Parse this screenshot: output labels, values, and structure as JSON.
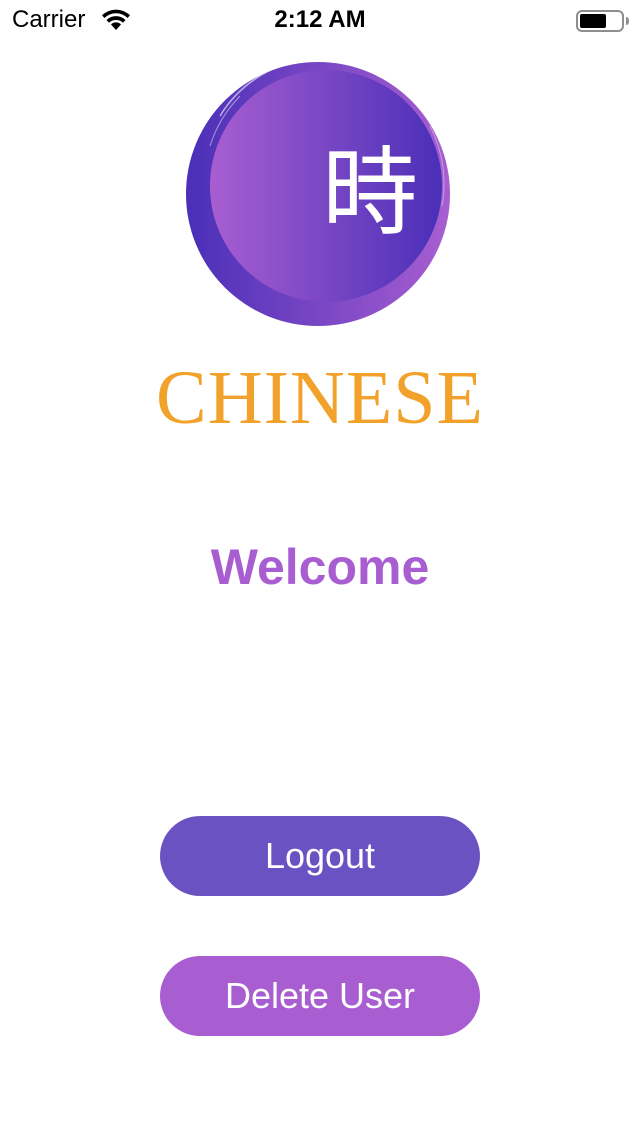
{
  "status_bar": {
    "carrier": "Carrier",
    "time": "2:12 AM",
    "wifi_icon": "wifi-icon",
    "battery_icon": "battery-icon"
  },
  "logo": {
    "glyph": "時",
    "brand": "CHINESE",
    "colors": {
      "circle_start": "#a85ed1",
      "circle_end": "#4a2fb8",
      "brand_text": "#f2a22a"
    }
  },
  "main": {
    "welcome": "Welcome"
  },
  "actions": {
    "logout_label": "Logout",
    "delete_label": "Delete User",
    "colors": {
      "logout": "#6a52c2",
      "delete": "#a85ed1"
    }
  }
}
